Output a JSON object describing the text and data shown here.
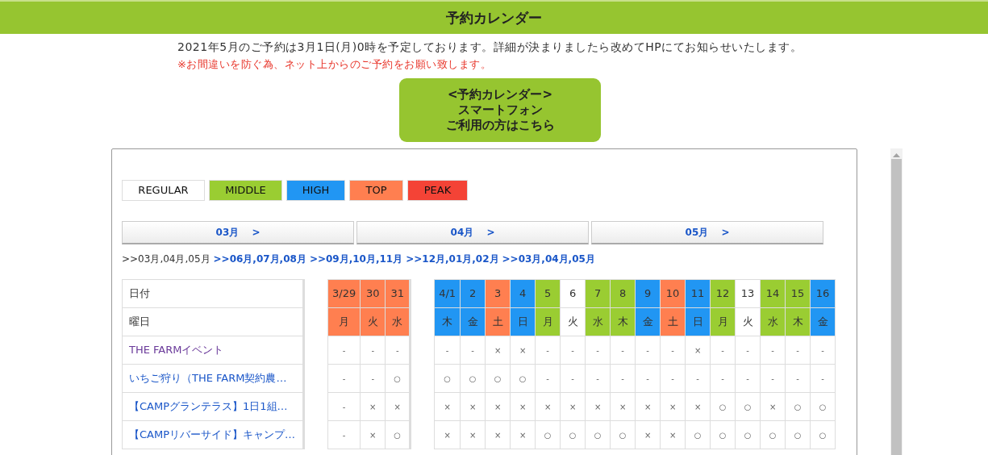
{
  "header": {
    "title": "予約カレンダー"
  },
  "notice": {
    "text": "2021年5月のご予約は3月1日(月)0時を予定しております。詳細が決まりましたら改めてHPにてお知らせいたします。",
    "warning": "※お間違いを防ぐ為、ネット上からのご予約をお願い致します。"
  },
  "smartphone_button": {
    "lines": [
      "<予約カレンダー>",
      "スマートフォン",
      "ご利用の方はこちら"
    ]
  },
  "legend": [
    {
      "label": "REGULAR",
      "color": "#ffffff"
    },
    {
      "label": "MIDDLE",
      "color": "#9acd32"
    },
    {
      "label": "HIGH",
      "color": "#2196f3"
    },
    {
      "label": "TOP",
      "color": "#ff7f50"
    },
    {
      "label": "PEAK",
      "color": "#f44336"
    }
  ],
  "month_buttons": [
    {
      "label": "03月",
      "arrow": ">"
    },
    {
      "label": "04月",
      "arrow": ">"
    },
    {
      "label": "05月",
      "arrow": ">"
    }
  ],
  "periods": [
    {
      "label": ">>03月,04月,05月",
      "selected": true
    },
    {
      "label": ">>06月,07月,08月",
      "selected": false
    },
    {
      "label": ">>09月,10月,11月",
      "selected": false
    },
    {
      "label": ">>12月,01月,02月",
      "selected": false
    },
    {
      "label": ">>03月,04月,05月",
      "selected": false
    }
  ],
  "table": {
    "header_labels": [
      "日付",
      "曜日"
    ],
    "months": [
      {
        "days": [
          {
            "date": "3/29",
            "weekday": "月",
            "color": "#ff7f50"
          },
          {
            "date": "30",
            "weekday": "火",
            "color": "#ff7f50"
          },
          {
            "date": "31",
            "weekday": "水",
            "color": "#ff7f50"
          }
        ]
      },
      {
        "days": [
          {
            "date": "4/1",
            "weekday": "木",
            "color": "#2196f3"
          },
          {
            "date": "2",
            "weekday": "金",
            "color": "#2196f3"
          },
          {
            "date": "3",
            "weekday": "土",
            "color": "#ff7f50"
          },
          {
            "date": "4",
            "weekday": "日",
            "color": "#2196f3"
          },
          {
            "date": "5",
            "weekday": "月",
            "color": "#9acd32"
          },
          {
            "date": "6",
            "weekday": "火",
            "color": "#ffffff"
          },
          {
            "date": "7",
            "weekday": "水",
            "color": "#9acd32"
          },
          {
            "date": "8",
            "weekday": "木",
            "color": "#9acd32"
          },
          {
            "date": "9",
            "weekday": "金",
            "color": "#2196f3"
          },
          {
            "date": "10",
            "weekday": "土",
            "color": "#ff7f50"
          },
          {
            "date": "11",
            "weekday": "日",
            "color": "#2196f3"
          },
          {
            "date": "12",
            "weekday": "月",
            "color": "#9acd32"
          },
          {
            "date": "13",
            "weekday": "火",
            "color": "#ffffff"
          },
          {
            "date": "14",
            "weekday": "水",
            "color": "#9acd32"
          },
          {
            "date": "15",
            "weekday": "木",
            "color": "#9acd32"
          },
          {
            "date": "16",
            "weekday": "金",
            "color": "#2196f3"
          }
        ]
      }
    ],
    "rows": [
      {
        "label": "THE FARMイベント",
        "visited": true,
        "cells": [
          [
            "-",
            "-",
            "-"
          ],
          [
            "-",
            "-",
            "×",
            "×",
            "-",
            "-",
            "-",
            "-",
            "-",
            "-",
            "×",
            "-",
            "-",
            "-",
            "-",
            "-"
          ]
        ]
      },
      {
        "label": "いちご狩り（THE FARM契約農…",
        "visited": false,
        "cells": [
          [
            "-",
            "-",
            "○"
          ],
          [
            "○",
            "○",
            "○",
            "○",
            "-",
            "-",
            "-",
            "-",
            "-",
            "-",
            "-",
            "-",
            "-",
            "-",
            "-",
            "-"
          ]
        ]
      },
      {
        "label": "【CAMPグランテラス】1日1組…",
        "visited": false,
        "cells": [
          [
            "-",
            "×",
            "×"
          ],
          [
            "×",
            "×",
            "×",
            "×",
            "×",
            "×",
            "×",
            "×",
            "×",
            "×",
            "×",
            "○",
            "○",
            "×",
            "○",
            "○"
          ]
        ]
      },
      {
        "label": "【CAMPリバーサイド】キャンプ…",
        "visited": false,
        "cells": [
          [
            "-",
            "×",
            "○"
          ],
          [
            "×",
            "×",
            "×",
            "×",
            "○",
            "○",
            "○",
            "○",
            "×",
            "×",
            "○",
            "○",
            "○",
            "○",
            "○",
            "○"
          ]
        ]
      }
    ]
  }
}
